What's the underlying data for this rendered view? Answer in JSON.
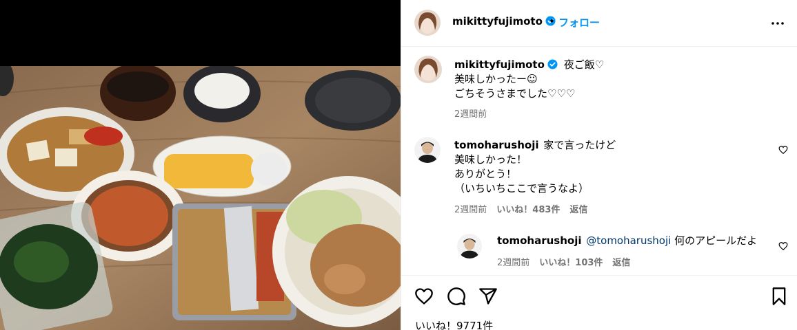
{
  "post": {
    "username": "mikittyfujimoto",
    "follow_label": "フォロー",
    "dot": "•"
  },
  "caption": {
    "username": "mikittyfujimoto",
    "text_line1": "夜ご飯♡",
    "text_line2": "美味しかったー☺︎",
    "text_line3": "ごちそうさまでした♡♡♡",
    "time": "2週間前"
  },
  "comments": [
    {
      "username": "tomoharushoji",
      "line1": "家で言ったけど",
      "line2": "美味しかった！",
      "line3": "ありがとう！",
      "line4": "（いちいちここで言うなよ）",
      "time": "2週間前",
      "likes": "いいね！483件",
      "reply": "返信"
    },
    {
      "username": "tomoharushoji",
      "mention": "@tomoharushoji",
      "text": " 何のアピールだよ",
      "time": "2週間前",
      "likes": "いいね！103件",
      "reply": "返信"
    }
  ],
  "footer": {
    "likes_count": "いいね！9771件"
  },
  "icons": [
    "verified-badge-icon",
    "more-icon",
    "heart-icon",
    "comment-icon",
    "share-icon",
    "bookmark-icon"
  ],
  "colors": {
    "link": "#0095f6",
    "verified": "#0095f6",
    "meta": "#737373",
    "mention": "#00376b"
  }
}
